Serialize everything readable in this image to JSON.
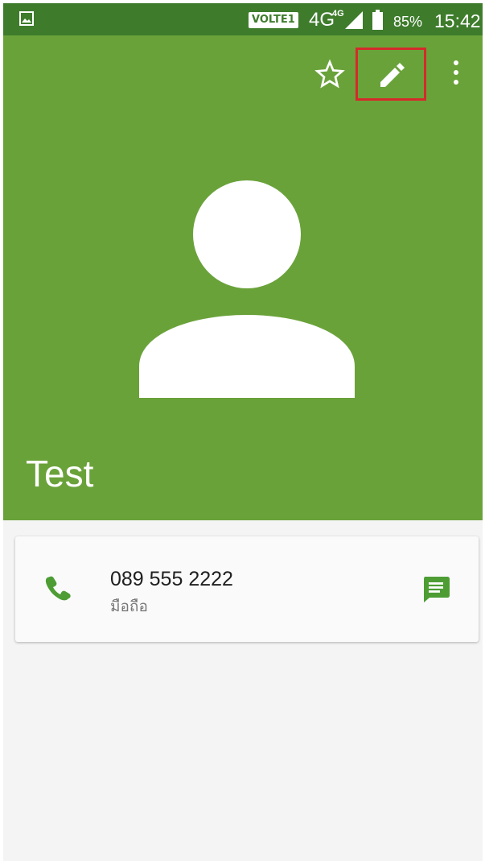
{
  "status_bar": {
    "volte": "VOLTE1",
    "network": "4G",
    "network_sub": "4G",
    "battery": "85%",
    "time": "15:42"
  },
  "contact": {
    "name": "Test",
    "phone_number": "089 555 2222",
    "phone_type": "มือถือ"
  },
  "icons": {
    "notification": "image-icon",
    "signal": "signal-icon",
    "battery": "battery-icon",
    "favorite": "star-outline-icon",
    "edit": "pencil-icon",
    "more": "more-vertical-icon",
    "avatar": "person-icon",
    "call": "phone-icon",
    "message": "message-icon"
  },
  "colors": {
    "status_bar": "#3e7c2c",
    "header": "#6aa23a",
    "highlight": "#d52a2a",
    "accent": "#4d9d34",
    "background": "#f4f4f4"
  }
}
